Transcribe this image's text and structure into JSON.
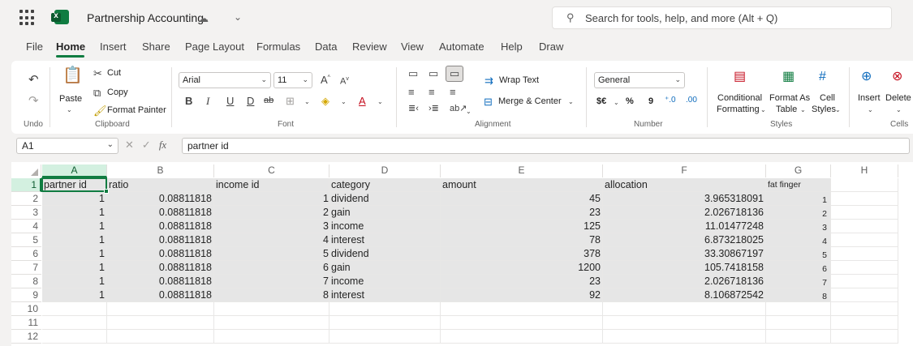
{
  "titlebar": {
    "app_icon": "excel-logo",
    "doc_title": "Partnership Accounting",
    "search_placeholder": "Search for tools, help, and more (Alt + Q)"
  },
  "tabs": [
    "File",
    "Home",
    "Insert",
    "Share",
    "Page Layout",
    "Formulas",
    "Data",
    "Review",
    "View",
    "Automate",
    "Help",
    "Draw"
  ],
  "active_tab": "Home",
  "ribbon": {
    "undo_group": "Undo",
    "clipboard": {
      "paste": "Paste",
      "cut": "Cut",
      "copy": "Copy",
      "format_painter": "Format Painter",
      "label": "Clipboard"
    },
    "font": {
      "name": "Arial",
      "size": "11",
      "label": "Font",
      "bold": "B",
      "italic": "I",
      "underline": "U",
      "double_underline": "D",
      "strike": "ab"
    },
    "alignment": {
      "wrap": "Wrap Text",
      "merge": "Merge & Center",
      "label": "Alignment"
    },
    "number": {
      "format": "General",
      "currency": "$€",
      "percent": "%",
      "comma": "9",
      "label": "Number"
    },
    "styles": {
      "conditional_1": "Conditional",
      "conditional_2": "Formatting",
      "format_as_1": "Format As",
      "format_as_2": "Table",
      "cell_1": "Cell",
      "cell_2": "Styles",
      "label": "Styles"
    },
    "cells": {
      "insert": "Insert",
      "delete": "Delete",
      "label": "Cells"
    }
  },
  "formula_bar": {
    "name_box": "A1",
    "fx": "fx",
    "formula": "partner id"
  },
  "columns": [
    "A",
    "B",
    "C",
    "D",
    "E",
    "F",
    "G",
    "H"
  ],
  "rows": [
    "1",
    "2",
    "3",
    "4",
    "5",
    "6",
    "7",
    "8",
    "9",
    "10",
    "11",
    "12"
  ],
  "sheet": {
    "headers": [
      "partner id",
      "ratio",
      "income id",
      "category",
      "amount",
      "allocation",
      "fat finger"
    ],
    "data": [
      [
        "1",
        "0.08811818",
        "1",
        "dividend",
        "45",
        "3.965318091",
        "1"
      ],
      [
        "1",
        "0.08811818",
        "2",
        "gain",
        "23",
        "2.026718136",
        "2"
      ],
      [
        "1",
        "0.08811818",
        "3",
        "income",
        "125",
        "11.01477248",
        "3"
      ],
      [
        "1",
        "0.08811818",
        "4",
        "interest",
        "78",
        "6.873218025",
        "4"
      ],
      [
        "1",
        "0.08811818",
        "5",
        "dividend",
        "378",
        "33.30867197",
        "5"
      ],
      [
        "1",
        "0.08811818",
        "6",
        "gain",
        "1200",
        "105.7418158",
        "6"
      ],
      [
        "1",
        "0.08811818",
        "7",
        "income",
        "23",
        "2.026718136",
        "7"
      ],
      [
        "1",
        "0.08811818",
        "8",
        "interest",
        "92",
        "8.106872542",
        "8"
      ]
    ]
  },
  "colors": {
    "accent": "#107c41",
    "selection": "#e6e6e6",
    "header_selected": "#d3f0e0"
  }
}
